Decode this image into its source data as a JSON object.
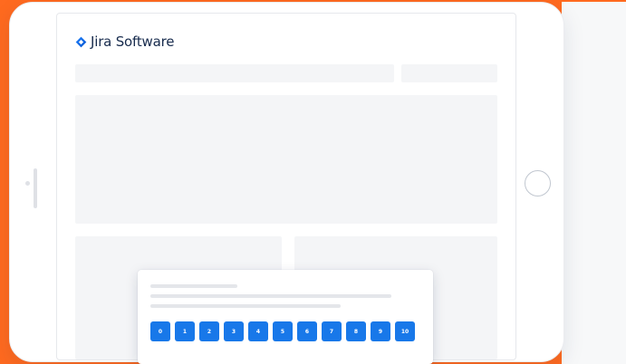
{
  "colors": {
    "background": "#FF6A1F",
    "brand_blue": "#2684FF",
    "button_blue": "#1878E9",
    "text_dark": "#172B4D"
  },
  "brand": {
    "icon": "jira-diamond-icon",
    "name": "Jira Software"
  },
  "survey": {
    "scale_options": [
      "0",
      "1",
      "2",
      "3",
      "4",
      "5",
      "6",
      "7",
      "8",
      "9",
      "10"
    ]
  }
}
